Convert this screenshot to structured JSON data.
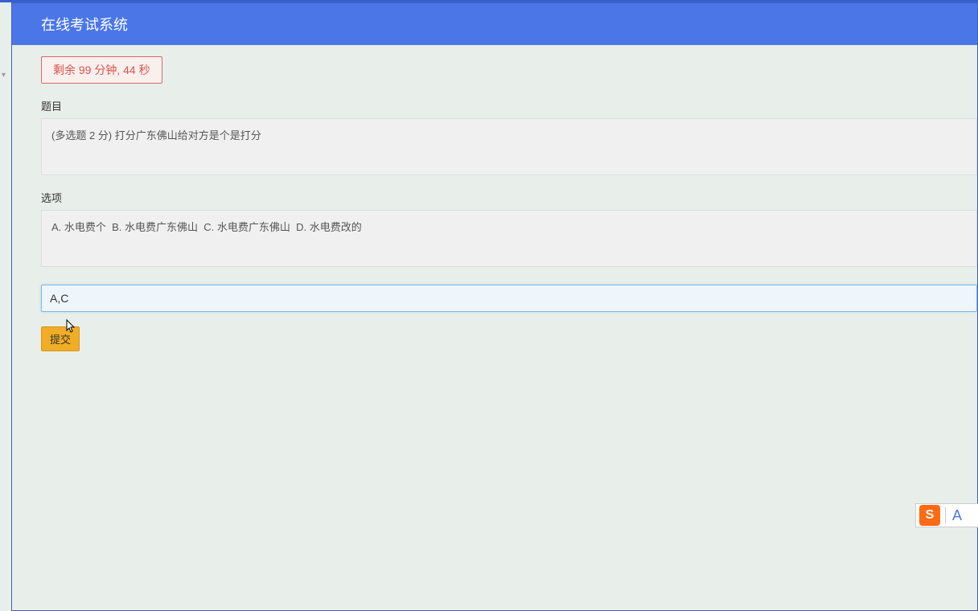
{
  "header": {
    "title": "在线考试系统"
  },
  "timer": {
    "text": "剩余 99 分钟, 44 秒"
  },
  "labels": {
    "question": "题目",
    "options": "选项"
  },
  "question": {
    "text": "(多选题 2 分) 打分广东佛山给对方是个是打分"
  },
  "options": {
    "optA": "A. 水电费个",
    "optB": "B. 水电费广东佛山",
    "optC": "C. 水电费广东佛山",
    "optD": "D. 水电费改的"
  },
  "answer": {
    "value": "A,C",
    "placeholder": ""
  },
  "buttons": {
    "submit": "提交"
  },
  "ime": {
    "icon_letter": "S",
    "mode": "A"
  }
}
